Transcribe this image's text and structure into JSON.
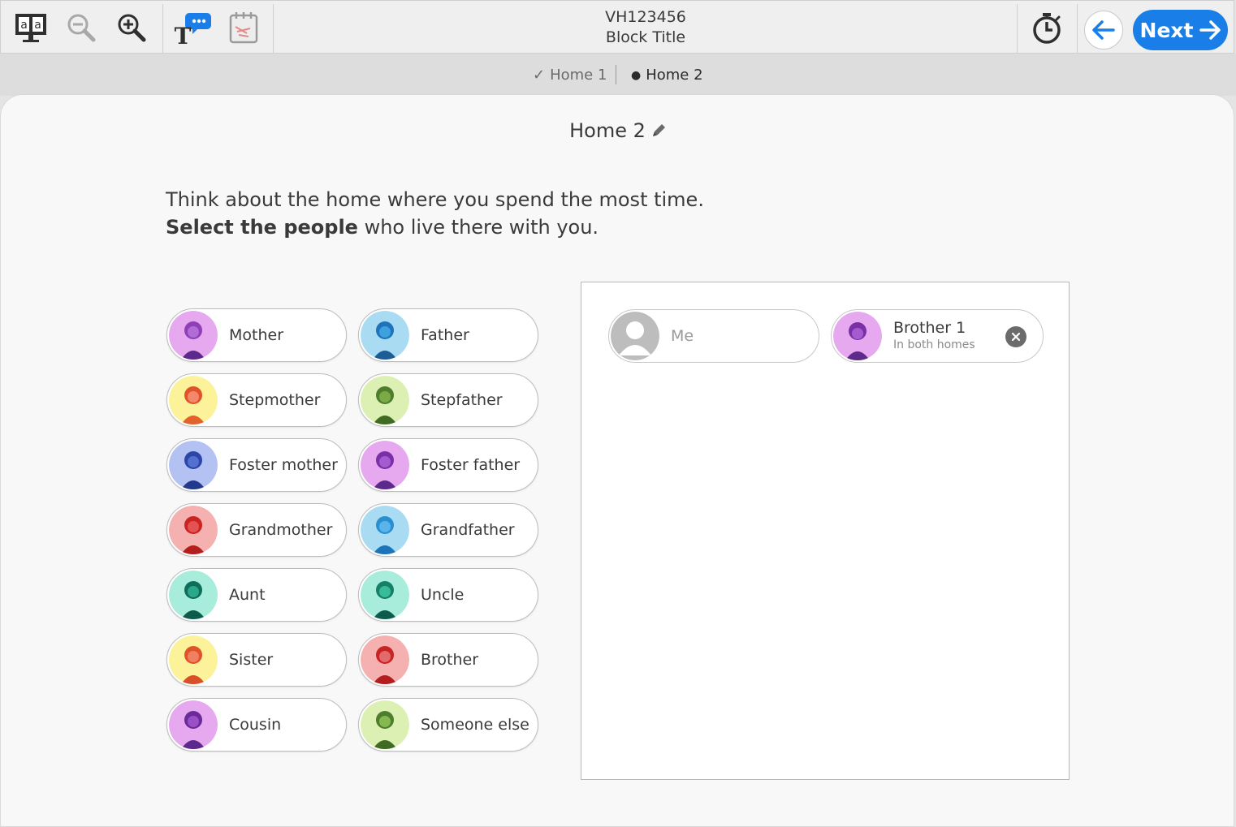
{
  "toolbar": {
    "assessment_id": "VH123456",
    "block_title": "Block Title",
    "tools": [
      {
        "name": "text-to-speech-icon"
      },
      {
        "name": "zoom-out-icon"
      },
      {
        "name": "zoom-in-icon"
      },
      {
        "name": "glossary-icon"
      },
      {
        "name": "notepad-icon"
      }
    ],
    "timer_icon": "stopwatch-icon",
    "back_icon": "arrow-left-icon",
    "next_label": "Next",
    "accent": "#1a7ee8"
  },
  "tabs": [
    {
      "label": "Home 1",
      "state": "completed",
      "marker": "✓"
    },
    {
      "label": "Home 2",
      "state": "current",
      "marker": "●"
    }
  ],
  "page": {
    "title": "Home 2",
    "instruction_line1": "Think about the home where you spend the most time.",
    "instruction_bold": "Select the people",
    "instruction_rest": " who live there with you."
  },
  "options": [
    {
      "label": "Mother",
      "color": "#e6a8ee"
    },
    {
      "label": "Father",
      "color": "#a9dcf3"
    },
    {
      "label": "Stepmother",
      "color": "#fbf29a"
    },
    {
      "label": "Stepfather",
      "color": "#dcf0b4"
    },
    {
      "label": "Foster mother",
      "color": "#b3c2f3"
    },
    {
      "label": "Foster father",
      "color": "#e6a8ee"
    },
    {
      "label": "Grandmother",
      "color": "#f5b0b0"
    },
    {
      "label": "Grandfather",
      "color": "#a9dcf3"
    },
    {
      "label": "Aunt",
      "color": "#a8ecdc"
    },
    {
      "label": "Uncle",
      "color": "#a8ecdc"
    },
    {
      "label": "Sister",
      "color": "#fbf29a"
    },
    {
      "label": "Brother",
      "color": "#f5b0b0"
    },
    {
      "label": "Cousin",
      "color": "#e6a8ee"
    },
    {
      "label": "Someone else",
      "color": "#dcf0b4"
    }
  ],
  "selected": {
    "me_label": "Me",
    "person_name": "Brother 1",
    "person_note": "In both homes",
    "person_color": "#e6a8ee"
  }
}
